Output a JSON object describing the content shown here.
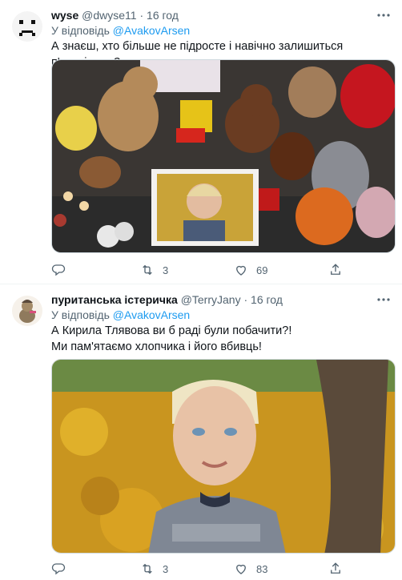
{
  "tweets": [
    {
      "name": "wyse",
      "handle": "@dwyse11",
      "dot": "·",
      "time": "16 год",
      "reply_prefix": "У відповідь",
      "reply_mention": "@AvakovArsen",
      "text_lines": [
        "А знаєш, хто більше не підросте і навічно залишиться п'ятирічним?"
      ],
      "media": "memorial-toys-photo",
      "replies": "",
      "retweets": "3",
      "likes": "69"
    },
    {
      "name": "пуританська істеричка",
      "handle": "@TerryJany",
      "dot": "·",
      "time": "16 год",
      "reply_prefix": "У відповідь",
      "reply_mention": "@AvakovArsen",
      "text_lines": [
        "А Кирила Тлявова ви б раді були побачити?!",
        "Ми пам'ятаємо хлопчика і його вбивць!"
      ],
      "media": "boy-autumn-leaves-photo",
      "replies": "",
      "retweets": "3",
      "likes": "83"
    }
  ],
  "icons": {
    "reply": "reply-icon",
    "retweet": "retweet-icon",
    "like": "heart-icon",
    "share": "share-icon",
    "more": "more-icon"
  },
  "colors": {
    "accent": "#1d9bf0",
    "secondary_text": "#536471",
    "primary_text": "#0f1419",
    "divider": "#eff3f4"
  }
}
